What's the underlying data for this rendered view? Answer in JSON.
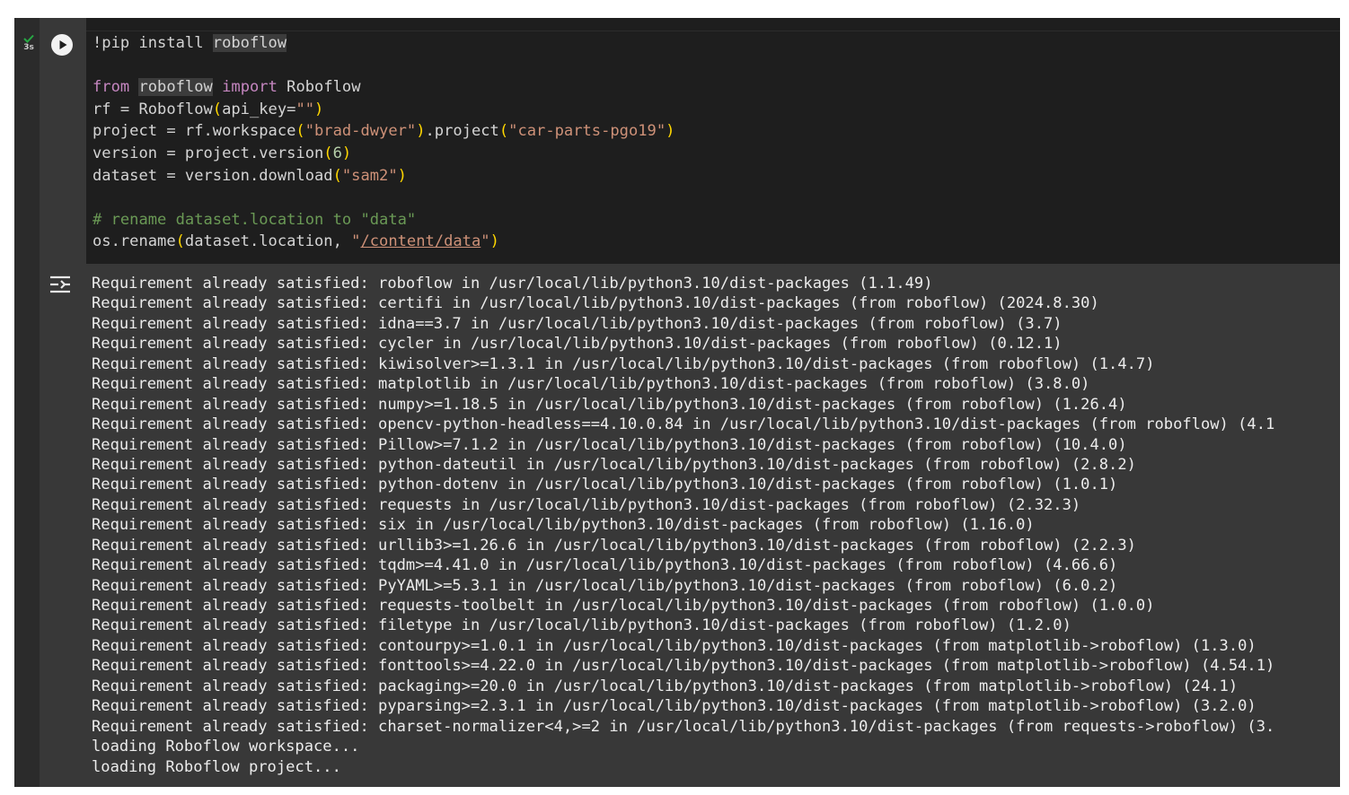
{
  "cell": {
    "execution_time": "3s",
    "status": "success",
    "code": {
      "line1": {
        "prefix": "!pip install ",
        "module": "roboflow"
      },
      "line3": {
        "kw_from": "from",
        "module": "roboflow",
        "kw_import": "import",
        "name": " Roboflow"
      },
      "line4": {
        "pre": "rf = Roboflow",
        "open": "(",
        "arg": "api_key=",
        "str": "\"\"",
        "close": ")"
      },
      "line5": {
        "pre": "project = rf.workspace",
        "open1": "(",
        "str1": "\"brad-dwyer\"",
        "close1": ")",
        "mid": ".project",
        "open2": "(",
        "str2": "\"car-parts-pgo19\"",
        "close2": ")"
      },
      "line6": {
        "pre": "version = project.version",
        "open": "(",
        "num": "6",
        "close": ")"
      },
      "line7": {
        "pre": "dataset = version.download",
        "open": "(",
        "str": "\"sam2\"",
        "close": ")"
      },
      "line9": {
        "comment": "# rename dataset.location to \"data\""
      },
      "line10": {
        "pre": "os.rename",
        "open": "(",
        "arg": "dataset.location, ",
        "q1": "\"",
        "path": "/content/data",
        "q2": "\"",
        "close": ")"
      }
    },
    "output_lines": [
      "Requirement already satisfied: roboflow in /usr/local/lib/python3.10/dist-packages (1.1.49)",
      "Requirement already satisfied: certifi in /usr/local/lib/python3.10/dist-packages (from roboflow) (2024.8.30)",
      "Requirement already satisfied: idna==3.7 in /usr/local/lib/python3.10/dist-packages (from roboflow) (3.7)",
      "Requirement already satisfied: cycler in /usr/local/lib/python3.10/dist-packages (from roboflow) (0.12.1)",
      "Requirement already satisfied: kiwisolver>=1.3.1 in /usr/local/lib/python3.10/dist-packages (from roboflow) (1.4.7)",
      "Requirement already satisfied: matplotlib in /usr/local/lib/python3.10/dist-packages (from roboflow) (3.8.0)",
      "Requirement already satisfied: numpy>=1.18.5 in /usr/local/lib/python3.10/dist-packages (from roboflow) (1.26.4)",
      "Requirement already satisfied: opencv-python-headless==4.10.0.84 in /usr/local/lib/python3.10/dist-packages (from roboflow) (4.1",
      "Requirement already satisfied: Pillow>=7.1.2 in /usr/local/lib/python3.10/dist-packages (from roboflow) (10.4.0)",
      "Requirement already satisfied: python-dateutil in /usr/local/lib/python3.10/dist-packages (from roboflow) (2.8.2)",
      "Requirement already satisfied: python-dotenv in /usr/local/lib/python3.10/dist-packages (from roboflow) (1.0.1)",
      "Requirement already satisfied: requests in /usr/local/lib/python3.10/dist-packages (from roboflow) (2.32.3)",
      "Requirement already satisfied: six in /usr/local/lib/python3.10/dist-packages (from roboflow) (1.16.0)",
      "Requirement already satisfied: urllib3>=1.26.6 in /usr/local/lib/python3.10/dist-packages (from roboflow) (2.2.3)",
      "Requirement already satisfied: tqdm>=4.41.0 in /usr/local/lib/python3.10/dist-packages (from roboflow) (4.66.6)",
      "Requirement already satisfied: PyYAML>=5.3.1 in /usr/local/lib/python3.10/dist-packages (from roboflow) (6.0.2)",
      "Requirement already satisfied: requests-toolbelt in /usr/local/lib/python3.10/dist-packages (from roboflow) (1.0.0)",
      "Requirement already satisfied: filetype in /usr/local/lib/python3.10/dist-packages (from roboflow) (1.2.0)",
      "Requirement already satisfied: contourpy>=1.0.1 in /usr/local/lib/python3.10/dist-packages (from matplotlib->roboflow) (1.3.0)",
      "Requirement already satisfied: fonttools>=4.22.0 in /usr/local/lib/python3.10/dist-packages (from matplotlib->roboflow) (4.54.1)",
      "Requirement already satisfied: packaging>=20.0 in /usr/local/lib/python3.10/dist-packages (from matplotlib->roboflow) (24.1)",
      "Requirement already satisfied: pyparsing>=2.3.1 in /usr/local/lib/python3.10/dist-packages (from matplotlib->roboflow) (3.2.0)",
      "Requirement already satisfied: charset-normalizer<4,>=2 in /usr/local/lib/python3.10/dist-packages (from requests->roboflow) (3.",
      "loading Roboflow workspace...",
      "loading Roboflow project..."
    ]
  },
  "icons": {
    "status": "check-icon",
    "run": "play-icon",
    "output_toggle": "output-toggle-icon"
  },
  "colors": {
    "cell_background": "#383838",
    "editor_background": "#1e1e1e",
    "success": "#27a844",
    "keyword": "#c586c0",
    "string": "#ce9178",
    "number": "#b5cea8",
    "bracket": "#ffd700",
    "comment": "#6a9955"
  }
}
